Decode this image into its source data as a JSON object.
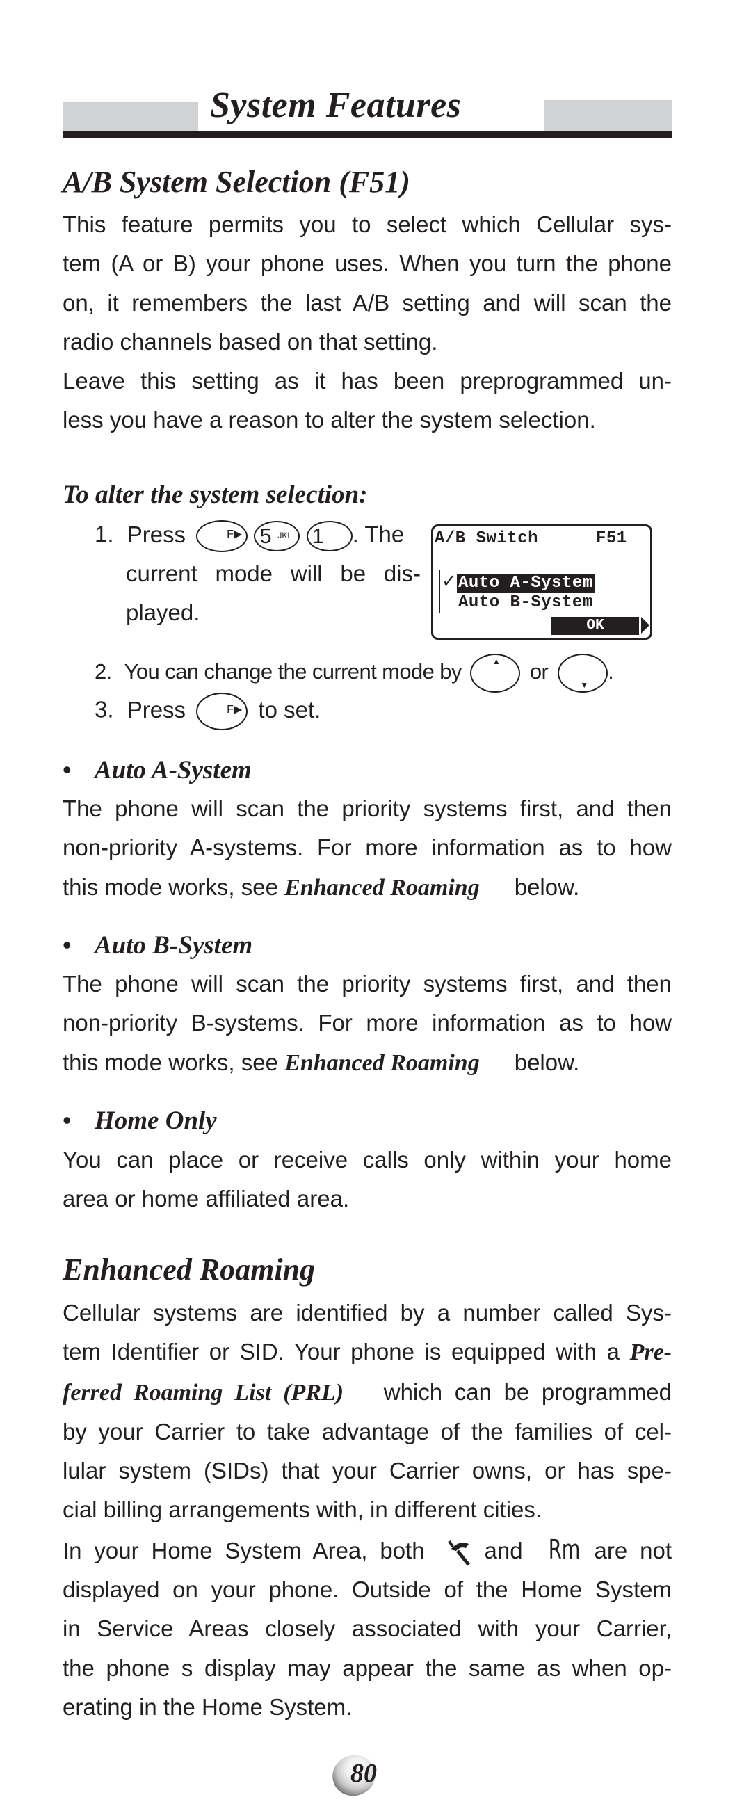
{
  "header": {
    "section_title": "System Features"
  },
  "ab_section": {
    "title": "A/B System Selection (F51)",
    "intro_lines": [
      "This feature permits you to select which Cellular sys-",
      "tem (A or B) your phone uses. When you turn the phone",
      "on, it remembers the last A/B setting and will scan the",
      "radio channels based on that setting.",
      "Leave this setting as it has been preprogrammed un-",
      "less you have a reason to alter the system selection."
    ],
    "procedure_title": "To alter the system selection:",
    "steps": [
      {
        "number": "1.",
        "press_label": "Press",
        "keys": [
          {
            "name": "function-key",
            "glyph": "F▶"
          },
          {
            "name": "5-key",
            "digit": "5",
            "letters": "JKL"
          },
          {
            "name": "1-key",
            "digit": "1",
            "letters": ""
          }
        ],
        "text_after": ". The",
        "continuation": [
          "current mode will be dis-",
          "played."
        ]
      },
      {
        "number": "2.",
        "text_before": "You can change the current mode by",
        "joiner": "or",
        "keys": [
          {
            "name": "up-navigation-key",
            "glyph": "▲"
          },
          {
            "name": "down-navigation-key",
            "glyph": "▼"
          }
        ],
        "text_after": "."
      },
      {
        "number": "3.",
        "press_label": "Press",
        "keys": [
          {
            "name": "function-key",
            "glyph": "F▶"
          }
        ],
        "text_after": "to set."
      }
    ],
    "lcd": {
      "title": "A/B Switch",
      "code": "F51",
      "check_glyph": "✓",
      "options": [
        {
          "label": "Auto A-System",
          "selected": true
        },
        {
          "label": "Auto B-System",
          "selected": false
        }
      ],
      "softkey": "OK"
    },
    "modes": [
      {
        "label": "Auto A-System",
        "lines": [
          "The phone will scan the priority systems first, and then",
          "non-priority A-systems. For more information as to how"
        ],
        "ref_prefix": "this mode works, see",
        "ref_link": "Enhanced Roaming",
        "ref_suffix": "below."
      },
      {
        "label": "Auto B-System",
        "lines": [
          "The phone will scan the priority systems first, and then",
          "non-priority B-systems. For more information as to how"
        ],
        "ref_prefix": "this mode works, see",
        "ref_link": "Enhanced Roaming",
        "ref_suffix": "below."
      },
      {
        "label": "Home Only",
        "lines": [
          "You can place or receive calls only within your home",
          "area or home affiliated area."
        ]
      }
    ],
    "bullet_glyph": "•"
  },
  "roaming_section": {
    "title": "Enhanced Roaming",
    "line1": "Cellular systems are identified by a number called Sys-",
    "line2_plain": "tem Identifier or SID. Your phone is equipped with a",
    "line2_em": "Pre-",
    "line3_em": "ferred Roaming List (PRL)",
    "line3_plain": "which can be programmed",
    "line4": "by your Carrier to take advantage of the families of cel-",
    "line5": "lular system (SIDs) that your Carrier owns, or has spe-",
    "line6": "cial billing arrangements with, in different cities.",
    "line7_a": "In your Home System Area, both",
    "line7_and": "and",
    "line7_rm": "Rm",
    "line7_b": "are not",
    "line8": "displayed on your phone. Outside of the Home System",
    "line9": "in Service Areas closely associated with your Carrier,",
    "line10": "the phone s display may appear the same as when op-",
    "line11": "erating in the Home System."
  },
  "footer": {
    "page_number": "80"
  }
}
